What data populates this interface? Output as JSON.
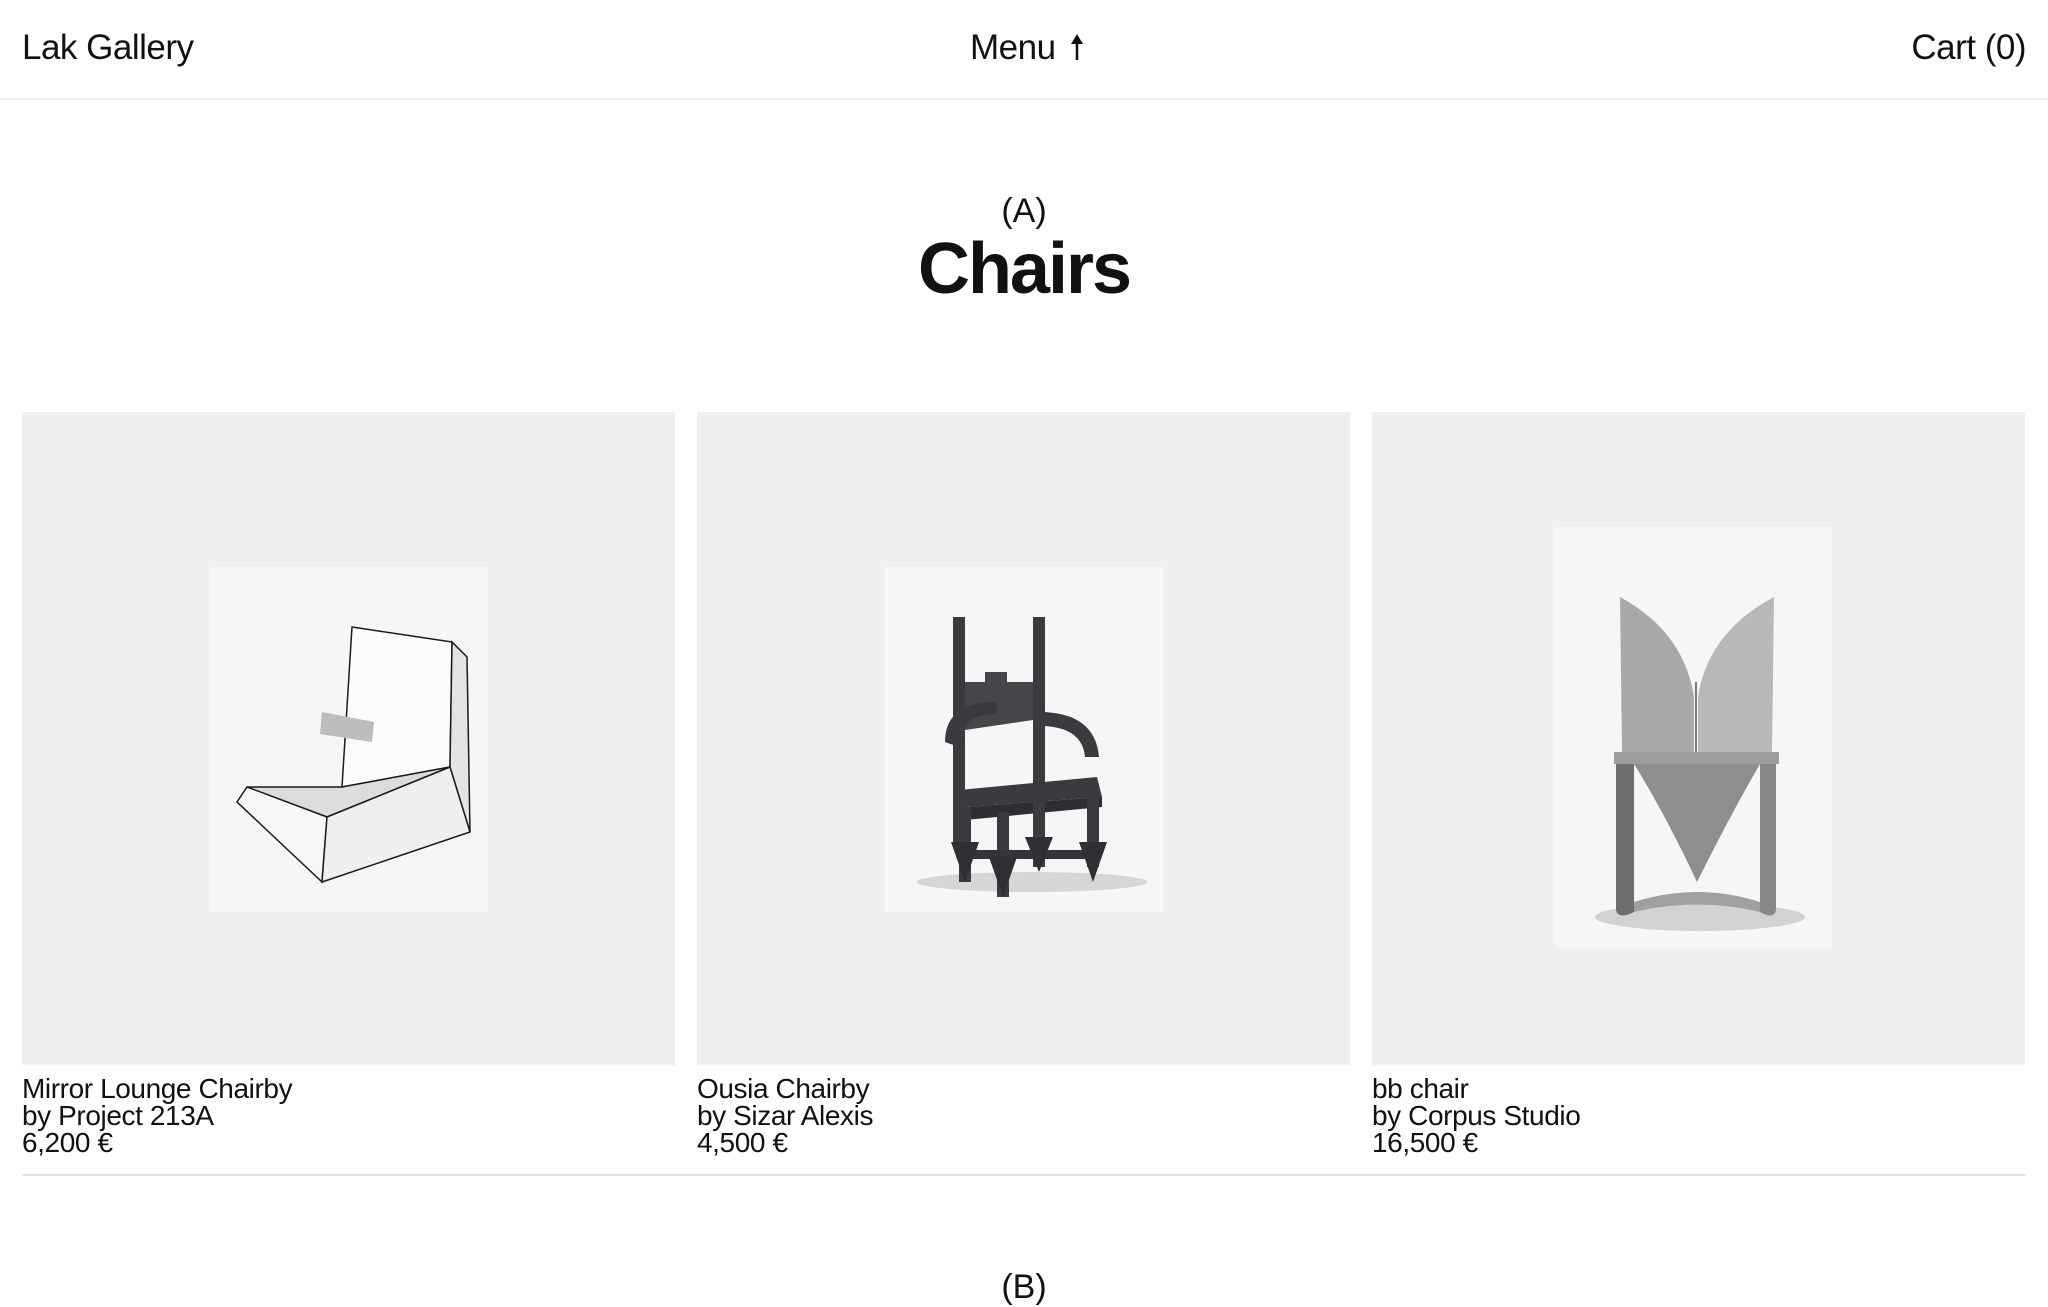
{
  "header": {
    "brand": "Lak Gallery",
    "menu_label": "Menu",
    "cart_label": "Cart (0)"
  },
  "section_a": {
    "letter": "(A)",
    "title": "Chairs"
  },
  "products": [
    {
      "name": "Mirror Lounge Chairby",
      "designer": "by Project 213A",
      "price": "6,200 €",
      "image": "mirror-lounge-chair-image"
    },
    {
      "name": "Ousia Chairby",
      "designer": "by Sizar Alexis",
      "price": "4,500 €",
      "image": "ousia-chair-image"
    },
    {
      "name": "bb chair",
      "designer": "by Corpus Studio",
      "price": "16,500 €",
      "image": "bb-chair-image"
    }
  ],
  "section_b": {
    "letter": "(B)"
  },
  "colors": {
    "background": "#ffffff",
    "thumbnail_background": "#efefef",
    "text": "#111111",
    "divider": "#e4e4e4"
  }
}
